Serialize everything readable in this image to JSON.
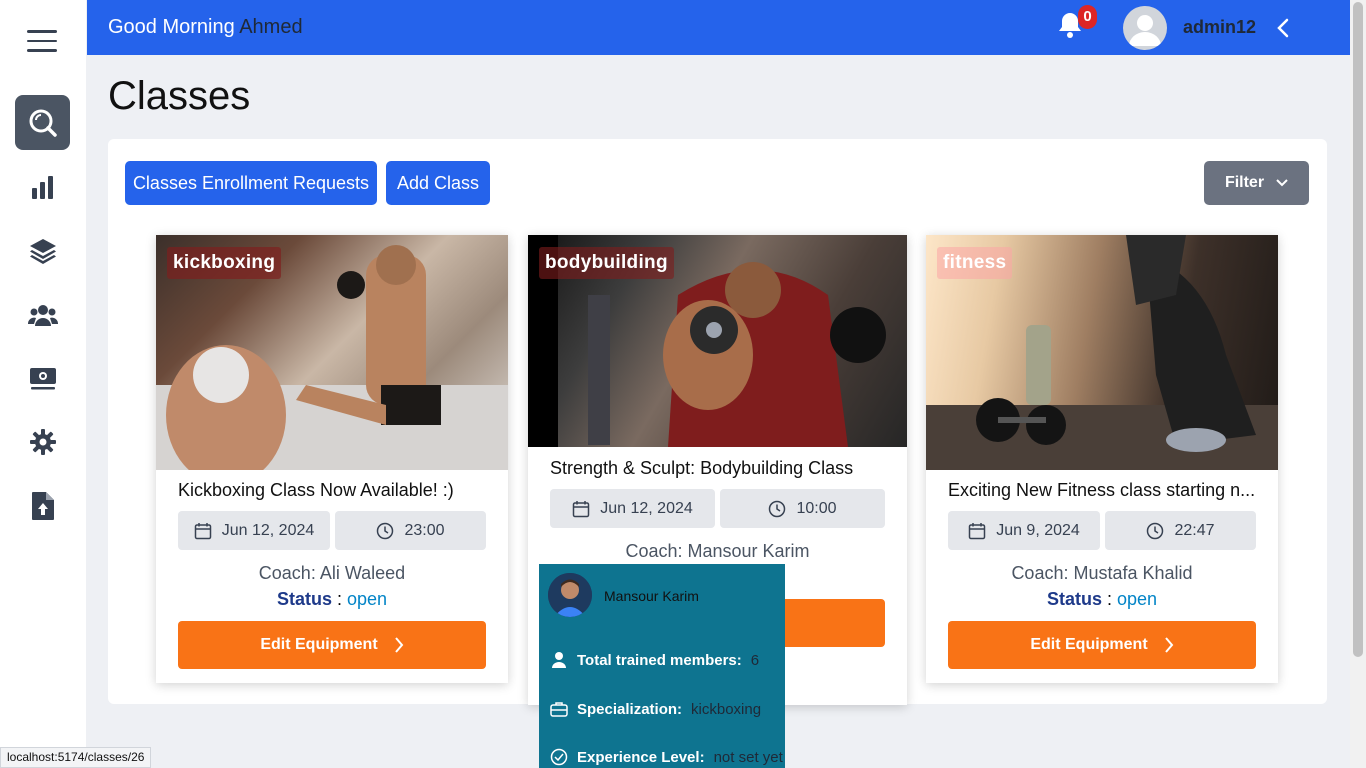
{
  "header": {
    "greeting": "Good Morning",
    "user_first_name": "Ahmed",
    "notification_count": "0",
    "username": "admin12"
  },
  "sidebar": {
    "items": [
      {
        "icon": "search-icon",
        "active": true
      },
      {
        "icon": "bar-chart-icon",
        "active": false
      },
      {
        "icon": "layers-icon",
        "active": false
      },
      {
        "icon": "users-icon",
        "active": false
      },
      {
        "icon": "money-icon",
        "active": false
      },
      {
        "icon": "gear-icon",
        "active": false
      },
      {
        "icon": "file-upload-icon",
        "active": false
      }
    ]
  },
  "page": {
    "title": "Classes",
    "enrollment_requests_label": "Classes Enrollment Requests",
    "add_class_label": "Add Class",
    "filter_label": "Filter"
  },
  "cards": [
    {
      "tag": "kickboxing",
      "title": "Kickboxing Class Now Available! :)",
      "date": "Jun 12, 2024",
      "time": "23:00",
      "coach": "Coach: Ali Waleed",
      "status_label": "Status",
      "status_value": "open",
      "edit_label": "Edit Equipment"
    },
    {
      "tag": "bodybuilding",
      "title": "Strength & Sculpt: Bodybuilding Class",
      "date": "Jun 12, 2024",
      "time": "10:00",
      "coach": "Coach: Mansour Karim"
    },
    {
      "tag": "fitness",
      "title": "Exciting New Fitness class starting n...",
      "date": "Jun 9, 2024",
      "time": "22:47",
      "coach": "Coach: Mustafa Khalid",
      "status_label": "Status",
      "status_value": "open",
      "edit_label": "Edit Equipment"
    }
  ],
  "coach_popup": {
    "name": "Mansour Karim",
    "members_label": "Total trained members:",
    "members_value": "6",
    "specialization_label": "Specialization:",
    "specialization_value": "kickboxing",
    "experience_label": "Experience Level:",
    "experience_value": "not set yet"
  },
  "status_bar": {
    "url": "localhost:5174/classes/26"
  },
  "colors": {
    "primary": "#2563eb",
    "accent": "#f97316",
    "popup": "#0e7490",
    "status_open": "#0284c7"
  }
}
